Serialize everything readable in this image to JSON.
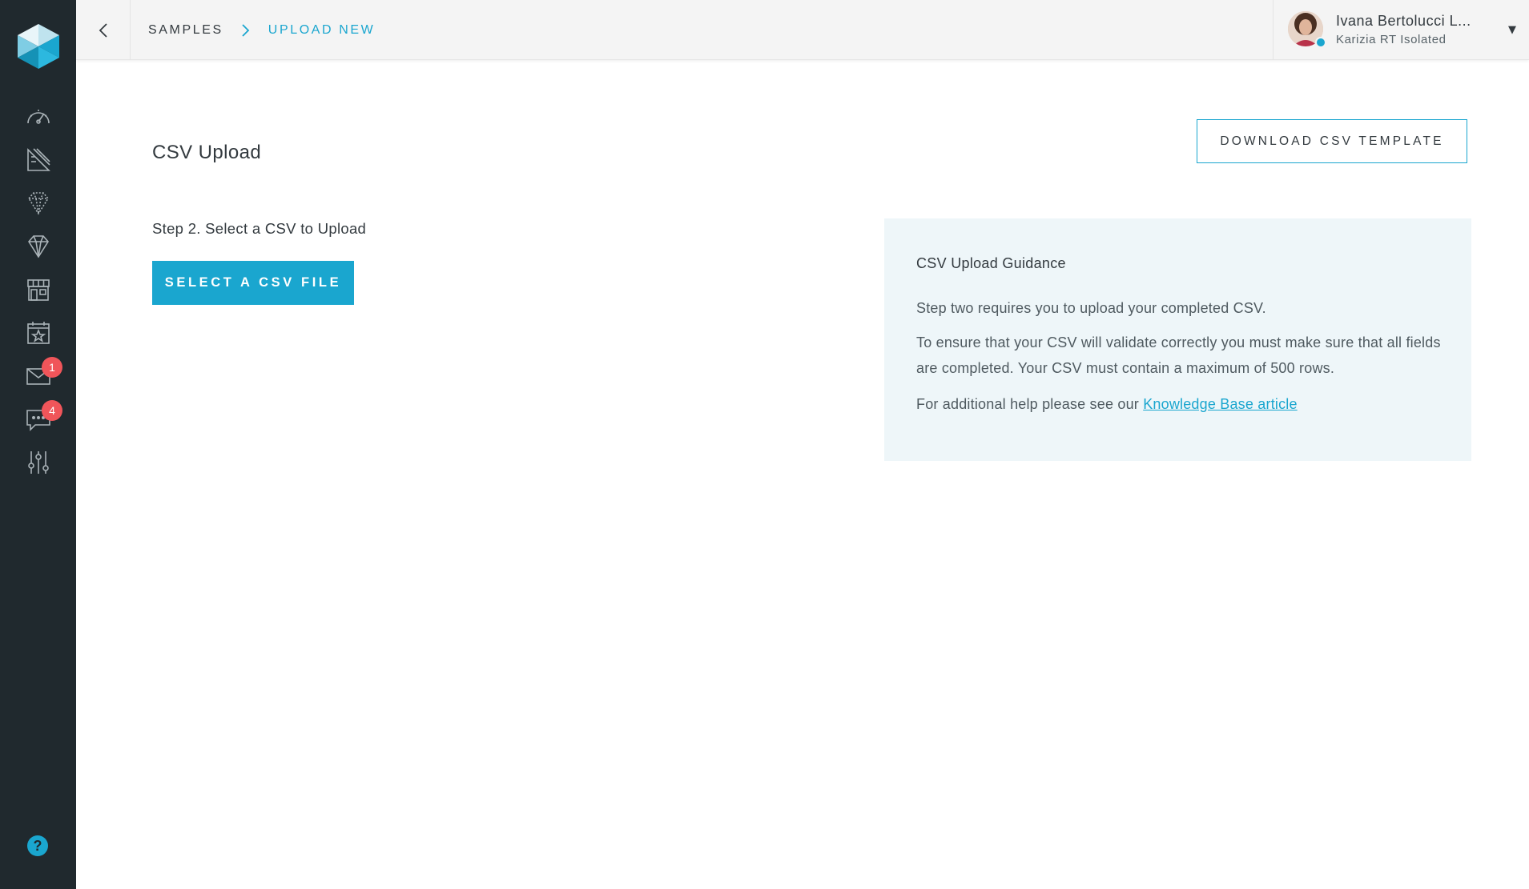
{
  "sidebar": {
    "logo_icon": "hexagon-cube-logo",
    "items": [
      {
        "name": "dashboard-icon"
      },
      {
        "name": "design-tools-icon"
      },
      {
        "name": "gem-outline-icon"
      },
      {
        "name": "diamond-icon"
      },
      {
        "name": "store-icon"
      },
      {
        "name": "calendar-star-icon"
      },
      {
        "name": "mail-icon",
        "badge": "1"
      },
      {
        "name": "chat-icon",
        "badge": "4"
      },
      {
        "name": "sliders-icon"
      }
    ],
    "help_label": "?"
  },
  "topbar": {
    "back_icon": "chevron-left-icon",
    "breadcrumb": [
      "SAMPLES",
      "UPLOAD NEW"
    ],
    "user": {
      "name": "Ivana Bertolucci L...",
      "subtitle": "Karizia RT Isolated"
    }
  },
  "main": {
    "title": "CSV Upload",
    "download_button": "DOWNLOAD CSV TEMPLATE",
    "step_label": "Step 2. Select a CSV to Upload",
    "select_button": "SELECT A CSV FILE",
    "guidance": {
      "title": "CSV Upload Guidance",
      "p1": "Step two requires you to upload your completed CSV.",
      "p2": "To ensure that your CSV will validate correctly you must make sure that all fields are completed. Your CSV must contain a maximum of 500 rows.",
      "p3_prefix": "For additional help please see our ",
      "p3_link": "Knowledge Base article"
    }
  },
  "colors": {
    "sidebar_bg": "#20292e",
    "accent": "#1aa6cf",
    "badge": "#f0555a",
    "guidance_bg": "#eef6f9"
  }
}
